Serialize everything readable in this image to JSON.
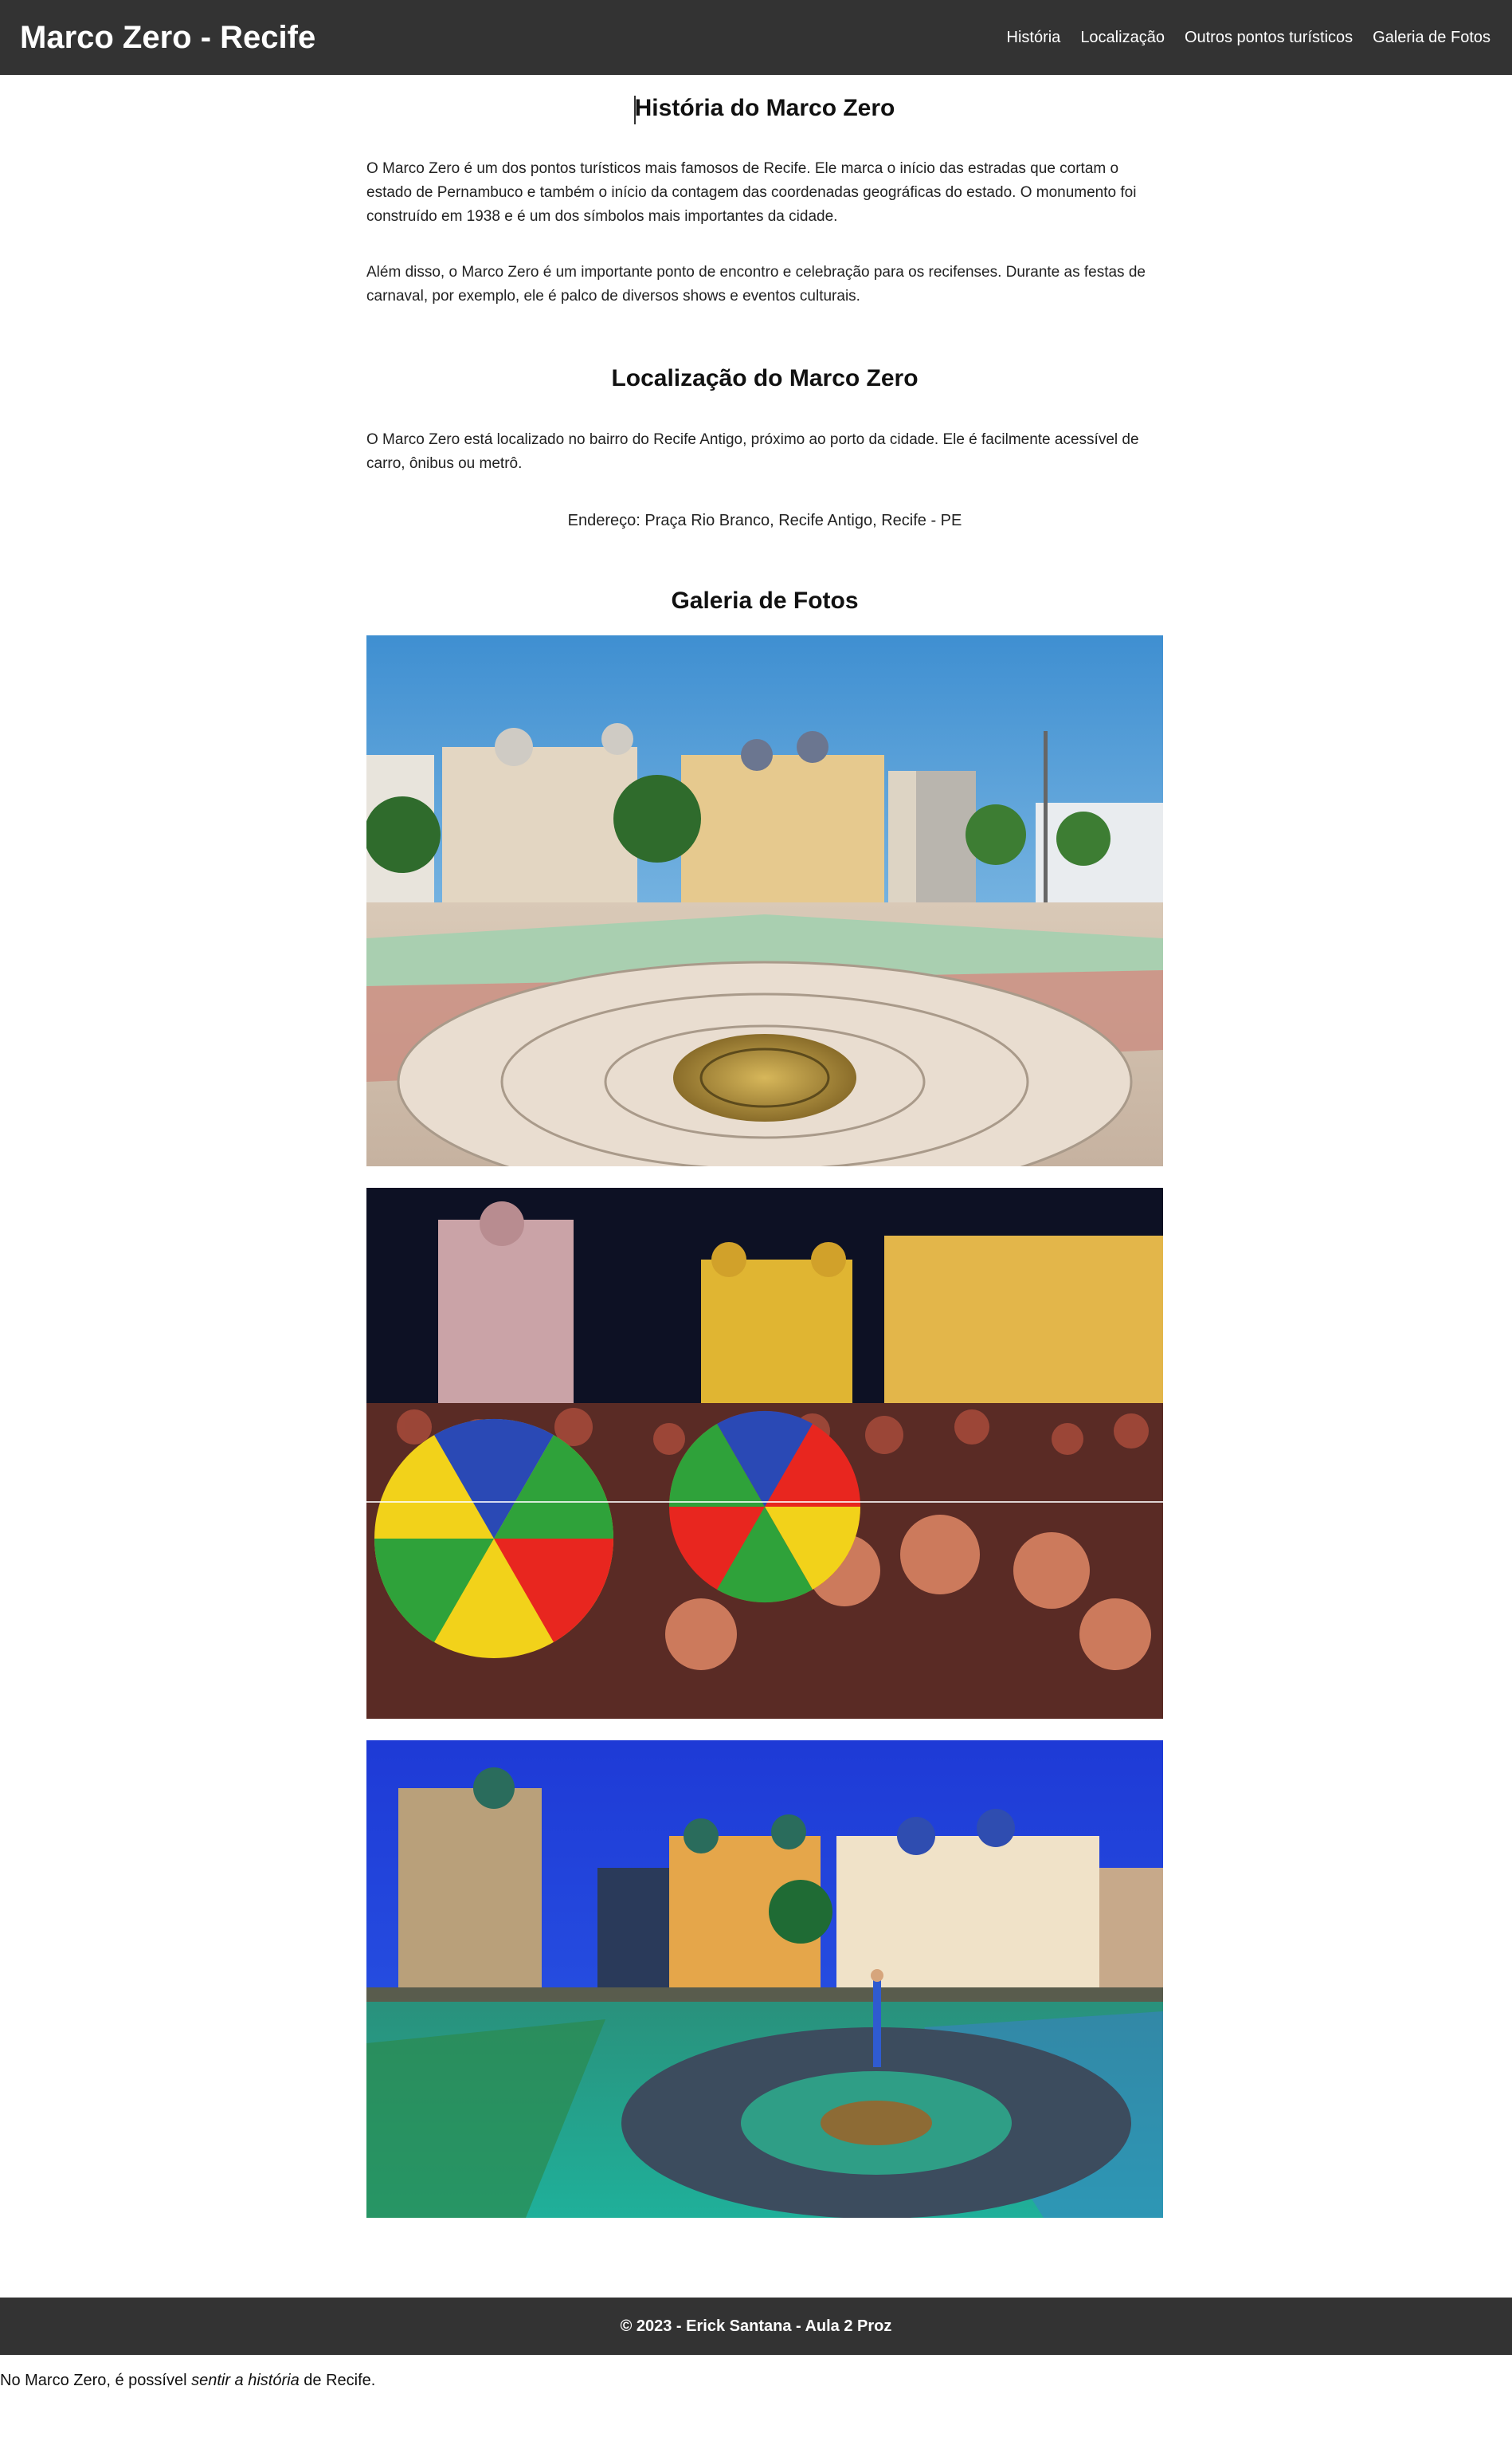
{
  "header": {
    "title": "Marco Zero - Recife",
    "nav": [
      "História",
      "Localização",
      "Outros pontos turísticos",
      "Galeria de Fotos"
    ]
  },
  "history": {
    "title": "História do Marco Zero",
    "p1": "O Marco Zero é um dos pontos turísticos mais famosos de Recife. Ele marca o início das estradas que cortam o estado de Pernambuco e também o início da contagem das coordenadas geográficas do estado. O monumento foi construído em 1938 e é um dos símbolos mais importantes da cidade.",
    "p2": "Além disso, o Marco Zero é um importante ponto de encontro e celebração para os recifenses. Durante as festas de carnaval, por exemplo, ele é palco de diversos shows e eventos culturais."
  },
  "location": {
    "title": "Localização do Marco Zero",
    "p1": "O Marco Zero está localizado no bairro do Recife Antigo, próximo ao porto da cidade. Ele é facilmente acessível de carro, ônibus ou metrô.",
    "address": "Endereço: Praça Rio Branco, Recife Antigo, Recife - PE"
  },
  "gallery": {
    "title": "Galeria de Fotos"
  },
  "footer": {
    "text": "© 2023 - Erick Santana - Aula 2 Proz"
  },
  "closing": {
    "before": "No Marco Zero, é possível ",
    "emphasis": "sentir a história",
    "after": " de Recife."
  },
  "colors": {
    "header_bg": "#333333",
    "footer_bg": "#333333",
    "text": "#222222"
  }
}
